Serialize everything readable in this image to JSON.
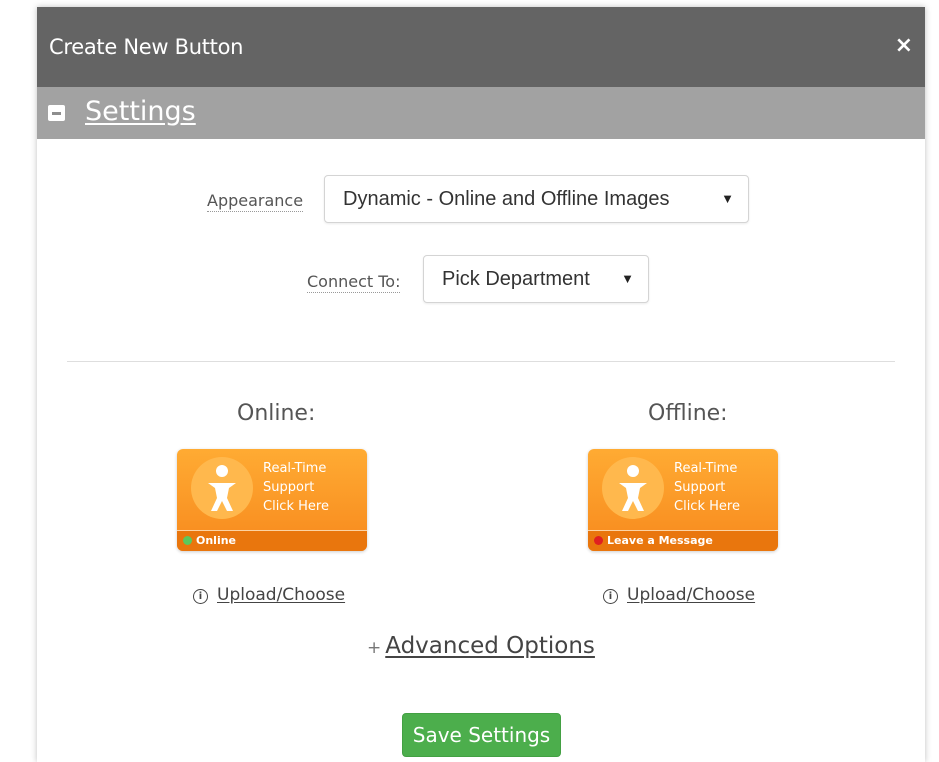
{
  "dialog": {
    "title": "Create New Button",
    "close_icon": "×",
    "section_title": "Settings"
  },
  "appearance": {
    "label": "Appearance",
    "value": "Dynamic - Online and Offline Images"
  },
  "connect_to": {
    "label": "Connect To:",
    "value": "Pick Department"
  },
  "online": {
    "label": "Online:",
    "button_lines": [
      "Real-Time",
      "Support",
      "Click Here"
    ],
    "status_text": "Online",
    "status_color": "#5cc85c",
    "upload_label": "Upload/Choose"
  },
  "offline": {
    "label": "Offline:",
    "button_lines": [
      "Real-Time",
      "Support",
      "Click Here"
    ],
    "status_text": "Leave a Message",
    "status_color": "#e02020",
    "upload_label": "Upload/Choose"
  },
  "advanced_options": {
    "prefix": "+",
    "label": "Advanced Options"
  },
  "save_button": {
    "label": "Save Settings"
  },
  "colors": {
    "title_bar": "#646464",
    "section_bar": "#a2a2a2",
    "accent_orange": "#f7891d",
    "save_green": "#4cae4c"
  }
}
